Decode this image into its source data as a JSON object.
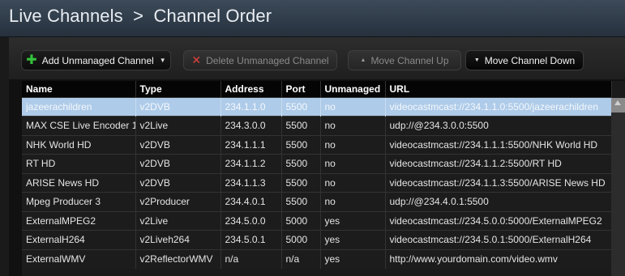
{
  "header": {
    "title": "Live Channels  >  Channel Order"
  },
  "toolbar": {
    "add_label": "Add Unmanaged Channel",
    "delete_label": "Delete Unmanaged Channel",
    "up_label": "Move Channel Up",
    "down_label": "Move Channel Down"
  },
  "table": {
    "columns": [
      "Name",
      "Type",
      "Address",
      "Port",
      "Unmanaged",
      "URL"
    ],
    "selected_row": 0,
    "rows": [
      [
        "jazeerachildren",
        "v2DVB",
        "234.1.1.0",
        "5500",
        "no",
        "videocastmcast://234.1.1.0:5500/jazeerachildren"
      ],
      [
        "MAX CSE Live Encoder 1",
        "v2Live",
        "234.3.0.0",
        "5500",
        "no",
        "udp://@234.3.0.0:5500"
      ],
      [
        "NHK World HD",
        "v2DVB",
        "234.1.1.1",
        "5500",
        "no",
        "videocastmcast://234.1.1.1:5500/NHK World HD"
      ],
      [
        "RT HD",
        "v2DVB",
        "234.1.1.2",
        "5500",
        "no",
        "videocastmcast://234.1.1.2:5500/RT HD"
      ],
      [
        "ARISE News HD",
        "v2DVB",
        "234.1.1.3",
        "5500",
        "no",
        "videocastmcast://234.1.1.3:5500/ARISE News HD"
      ],
      [
        "Mpeg Producer 3",
        "v2Producer",
        "234.4.0.1",
        "5500",
        "no",
        "udp://@234.4.0.1:5500"
      ],
      [
        "ExternalMPEG2",
        "v2Live",
        "234.5.0.0",
        "5000",
        "yes",
        "videocastmcast://234.5.0.0:5000/ExternalMPEG2"
      ],
      [
        "ExternalH264",
        "v2Liveh264",
        "234.5.0.1",
        "5000",
        "yes",
        "videocastmcast://234.5.0.1:5000/ExternalH264"
      ],
      [
        "ExternalWMV",
        "v2ReflectorWMV",
        "n/a",
        "n/a",
        "yes",
        "http://www.yourdomain.com/video.wmv"
      ]
    ]
  },
  "icons": {
    "add": "plus-icon",
    "delete": "x-icon",
    "up": "triangle-up-icon",
    "down": "triangle-down-icon",
    "dropdown": "caret-down-icon"
  },
  "colors": {
    "add_icon": "#34c33c",
    "delete_icon": "#e0423c",
    "selection": "#aecbe9",
    "header_bg": "#050505",
    "titlebar": "#2f3b48"
  }
}
